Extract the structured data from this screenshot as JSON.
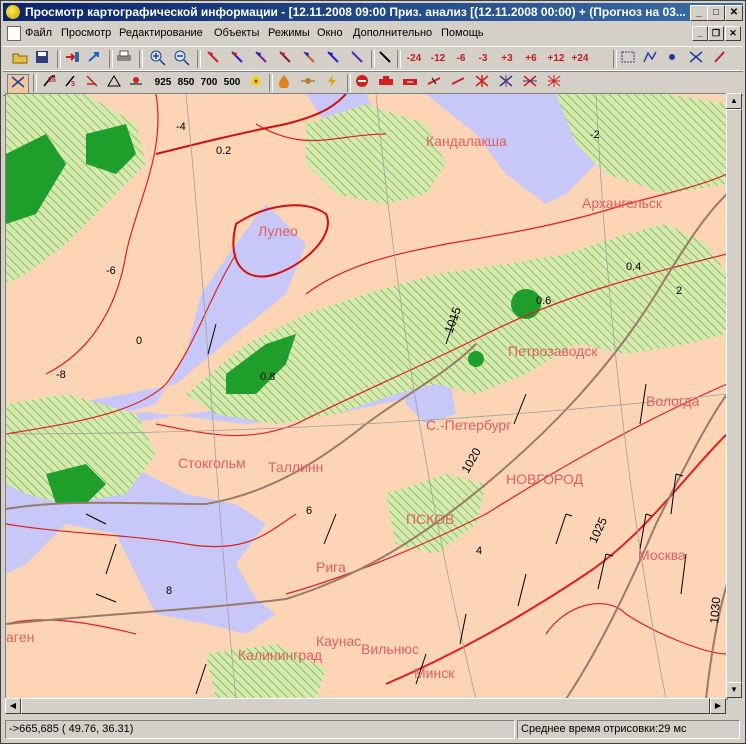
{
  "window": {
    "title": "Просмотр картографической информации - [12.11.2008  09:00  Приз. анализ [(12.11.2008 00:00) + (Прогноз на 03...",
    "minimize": "_",
    "maximize": "□",
    "close": "✕"
  },
  "menu": {
    "items": [
      "Файл",
      "Просмотр",
      "Редактирование",
      "Объекты",
      "Режимы",
      "Окно",
      "Дополнительно",
      "Помощь"
    ]
  },
  "toolbar1": {
    "time_steps": [
      "-24",
      "-12",
      "-6",
      "-3",
      "+3",
      "+6",
      "+12",
      "+24"
    ]
  },
  "toolbar2": {
    "levels": [
      "925",
      "850",
      "700",
      "500"
    ]
  },
  "map": {
    "cities": [
      "Лулео",
      "Петрозаводск",
      "С.-Петербург",
      "Вологда",
      "Стокгольм",
      "Таллинн",
      "НОВГОРОД",
      "ПСКОВ",
      "Рига",
      "Москва",
      "Каунас",
      "Калининград",
      "Вильнюс",
      "Минск",
      "агeн",
      "Архангельск",
      "Кандалакша"
    ],
    "isobars": [
      "1015",
      "1020",
      "1025",
      "1030"
    ],
    "values": [
      "0.2",
      "0.4",
      "0.6",
      "0.8",
      "-2",
      "-4",
      "-6",
      "-8",
      "0",
      "2",
      "4",
      "6",
      "8"
    ]
  },
  "status": {
    "cursor": "->665,685  ( 49.76, 36.31)",
    "render_time": "Среднее время отрисовки:29 мс"
  },
  "colors": {
    "titlebar_start": "#0a246a",
    "titlebar_end": "#3a6ea5",
    "land": "#fbd5b5",
    "water": "#c8c8f8",
    "precip_light": "#c8e6a0",
    "precip_heavy": "#1e9e2a",
    "isotherm": "#e02020",
    "isobar": "#9a7a6a"
  }
}
